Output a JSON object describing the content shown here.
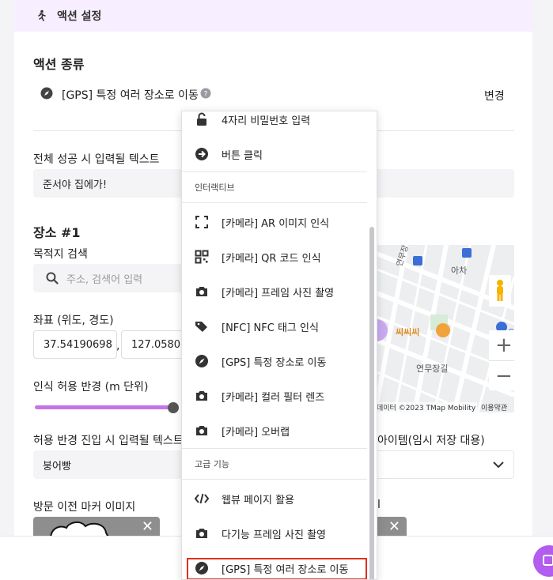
{
  "header": {
    "title": "액션 설정"
  },
  "action_type": {
    "section_title": "액션 종류",
    "selected_label": "[GPS] 특정 여러 장소로 이동",
    "change_button": "변경"
  },
  "success_text": {
    "label": "전체 성공 시 입력될 텍스트",
    "value": "준서야 집에가!"
  },
  "place": {
    "section_title": "장소 #1",
    "search_label": "목적지 검색",
    "search_placeholder": "주소, 검색어 입력",
    "coords_label": "좌표 (위도, 경도)",
    "lat": "37.54190698",
    "comma": ",",
    "lng": "127.05808",
    "radius_label": "인식 허용 반경 (m 단위)",
    "radius_fraction": 0.9
  },
  "map": {
    "streets": [
      "연무장13길",
      "아차",
      "연무장길"
    ],
    "poi": "씨씨씨",
    "attribution": "데이터 ©2023 TMap Mobility",
    "terms": "이용약관",
    "zoom_in": "+",
    "zoom_out": "−",
    "edge_label": "C"
  },
  "enter_text": {
    "label": "허용 반경 진입 시 입력될 텍스트",
    "value": "붕어빵"
  },
  "item_select": {
    "label": "아이템(임시 저장 대용)"
  },
  "marker_before": {
    "label": "방문 이전 마커 이미지",
    "close": "✕"
  },
  "marker_after": {
    "label_fragment": "l",
    "close": "✕"
  },
  "dropdown": {
    "items_top": [
      {
        "icon": "lock-open-icon",
        "label": "4자리 비밀번호 입력"
      },
      {
        "icon": "arrow-circle-icon",
        "label": "버튼 클릭"
      }
    ],
    "group_interactive": "인터랙티브",
    "items_interactive": [
      {
        "icon": "scan-frame-icon",
        "label": "[카메라] AR 이미지 인식"
      },
      {
        "icon": "qr-code-icon",
        "label": "[카메라] QR 코드 인식"
      },
      {
        "icon": "camera-icon",
        "label": "[카메라] 프레임 사진 촬영"
      },
      {
        "icon": "tag-icon",
        "label": "[NFC] NFC 태그 인식"
      },
      {
        "icon": "compass-icon",
        "label": "[GPS] 특정 장소로 이동"
      },
      {
        "icon": "camera-icon",
        "label": "[카메라] 컬러 필터 렌즈"
      },
      {
        "icon": "camera-icon",
        "label": "[카메라] 오버랩"
      }
    ],
    "group_advanced": "고급 기능",
    "items_advanced": [
      {
        "icon": "code-icon",
        "label": "웹뷰 페이지 활용"
      },
      {
        "icon": "camera-icon",
        "label": "다기능 프레임 사진 촬영"
      },
      {
        "icon": "compass-icon",
        "label": "[GPS] 특정 여러 장소로 이동"
      }
    ]
  },
  "colors": {
    "accent": "#c473e8",
    "header_bg": "#f7efff",
    "selected_outline": "#e0301e",
    "map_poi": "#f2a23a"
  }
}
